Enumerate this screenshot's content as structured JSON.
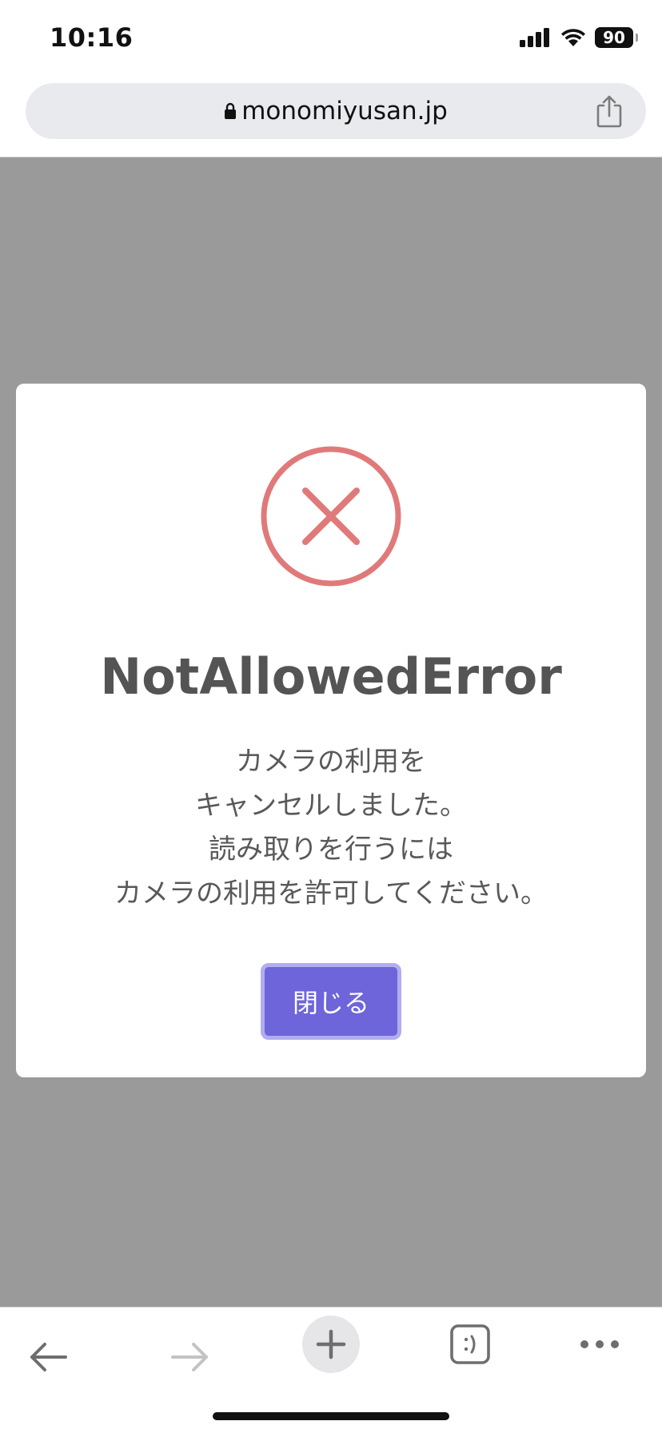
{
  "status_bar": {
    "time": "10:16",
    "battery_level": "90",
    "icons": [
      "cellular-signal-icon",
      "wifi-icon",
      "battery-icon"
    ]
  },
  "browser": {
    "url": "monomiyusan.jp",
    "icons": [
      "lock-icon",
      "share-icon"
    ]
  },
  "modal": {
    "icon": "error-x-circle-icon",
    "title": "NotAllowedError",
    "message_lines": [
      "カメラの利用を",
      "キャンセルしました。",
      "読み取りを行うには",
      "カメラの利用を許可してください。"
    ],
    "close_label": "閉じる"
  },
  "toolbar": {
    "icons": [
      "back-arrow-icon",
      "forward-arrow-icon",
      "new-tab-plus-icon",
      "tabs-icon",
      "more-icon"
    ]
  },
  "colors": {
    "error_red": "#e07a7a",
    "button_purple": "#6d65d9",
    "button_border": "#b2adf0",
    "overlay_gray": "#9a9a9a",
    "title_text": "#545454"
  }
}
